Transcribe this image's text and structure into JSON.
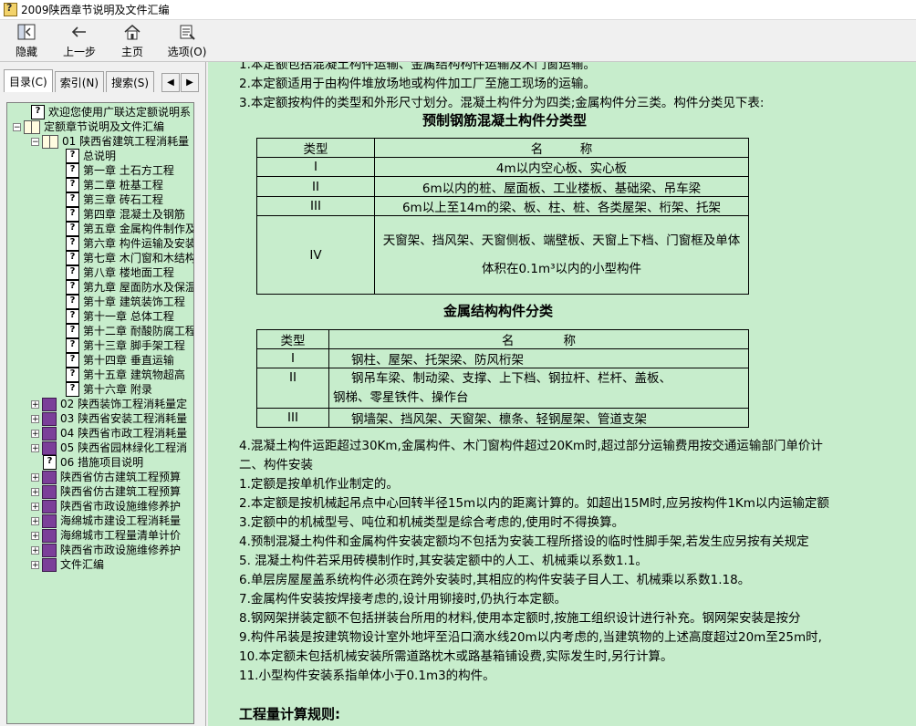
{
  "window": {
    "title": "2009陕西章节说明及文件汇编"
  },
  "toolbar": {
    "hide_label": "隐藏",
    "back_label": "上一步",
    "home_label": "主页",
    "options_label": "选项(O)"
  },
  "tabs": {
    "contents": "目录(C)",
    "index": "索引(N)",
    "search": "搜索(S)"
  },
  "tree": [
    "欢迎您使用广联达定额说明系",
    "定额章节说明及文件汇编",
    "01 陕西省建筑工程消耗量",
    "总说明",
    "第一章 土石方工程",
    "第二章 桩基工程",
    "第三章 砖石工程",
    "第四章 混凝土及钢筋",
    "第五章 金属构件制作及",
    "第六章 构件运输及安装",
    "第七章 木门窗和木结构",
    "第八章 楼地面工程",
    "第九章 屋面防水及保温",
    "第十章 建筑装饰工程",
    "第十一章 总体工程",
    "第十二章 耐酸防腐工程",
    "第十三章 脚手架工程",
    "第十四章 垂直运输",
    "第十五章 建筑物超高",
    "第十六章 附录",
    "02 陕西装饰工程消耗量定",
    "03 陕西省安装工程消耗量",
    "04 陕西省市政工程消耗量",
    "05 陕西省园林绿化工程消",
    "06 措施项目说明",
    "陕西省仿古建筑工程预算",
    "陕西省仿古建筑工程预算",
    "陕西省市政设施维修养护",
    "海绵城市建设工程消耗量",
    "海绵城市工程量清单计价",
    "陕西省市政设施维修养护",
    "文件汇编"
  ],
  "content": {
    "line_top": "1.本定额包括混凝土构件运输、金属结构构件运输及木门窗运输。",
    "line2": "2.本定额适用于由构件堆放场地或构件加工厂至施工现场的运输。",
    "line3": "3.本定额按构件的类型和外形尺寸划分。混凝土构件分为四类;金属构件分三类。构件分类见下表:",
    "table1_title": "预制钢筋混凝土构件分类型",
    "table1_header": [
      "类型",
      "名　　　称"
    ],
    "table1_rows": [
      [
        "I",
        "4m以内空心板、实心板"
      ],
      [
        "II",
        "6m以内的桩、屋面板、工业楼板、基础梁、吊车梁"
      ],
      [
        "III",
        "6m以上至14m的梁、板、柱、桩、各类屋架、桁架、托架"
      ],
      [
        "IV",
        "天窗架、挡风架、天窗侧板、端壁板、天窗上下档、门窗框及单体",
        "体积在0.1m³以内的小型构件"
      ]
    ],
    "table2_title": "金属结构构件分类",
    "table2_header": [
      "类型",
      "名　　　　称"
    ],
    "table2_rows": [
      [
        "I",
        "钢柱、屋架、托架梁、防风桁架"
      ],
      [
        "II",
        "钢吊车梁、制动梁、支撑、上下档、钢拉杆、栏杆、盖板、",
        "钢梯、零星铁件、操作台"
      ],
      [
        "III",
        "钢墙架、挡风架、天窗架、檩条、轻钢屋架、管道支架"
      ]
    ],
    "line4": "4.混凝土构件运距超过30Km,金属构件、木门窗构件超过20Km时,超过部分运输费用按交通运输部门单价计",
    "section2": "二、构件安装",
    "i1": "1.定额是按单机作业制定的。",
    "i2": "2.本定额是按机械起吊点中心回转半径15m以内的距离计算的。如超出15M时,应另按构件1Km以内运输定额",
    "i3": "3.定额中的机械型号、吨位和机械类型是综合考虑的,使用时不得换算。",
    "i4": "4.预制混凝土构件和金属构件安装定额均不包括为安装工程所搭设的临时性脚手架,若发生应另按有关规定",
    "i5": "5. 混凝土构件若采用砖模制作时,其安装定额中的人工、机械乘以系数1.1。",
    "i6": "6.单层房屋屋盖系统构件必须在跨外安装时,其相应的构件安装子目人工、机械乘以系数1.18。",
    "i7": "7.金属构件安装按焊接考虑的,设计用铆接时,仍执行本定额。",
    "i8": "8.钢网架拼装定额不包括拼装台所用的材料,使用本定额时,按施工组织设计进行补充。钢网架安装是按分",
    "i9": "9.构件吊装是按建筑物设计室外地坪至沿口滴水线20m以内考虑的,当建筑物的上述高度超过20m至25m时,",
    "i10": "10.本定额未包括机械安装所需道路枕木或路基箱铺设费,实际发生时,另行计算。",
    "i11": "11.小型构件安装系指单体小于0.1m3的构件。",
    "rules_title": "工程量计算规则:"
  }
}
